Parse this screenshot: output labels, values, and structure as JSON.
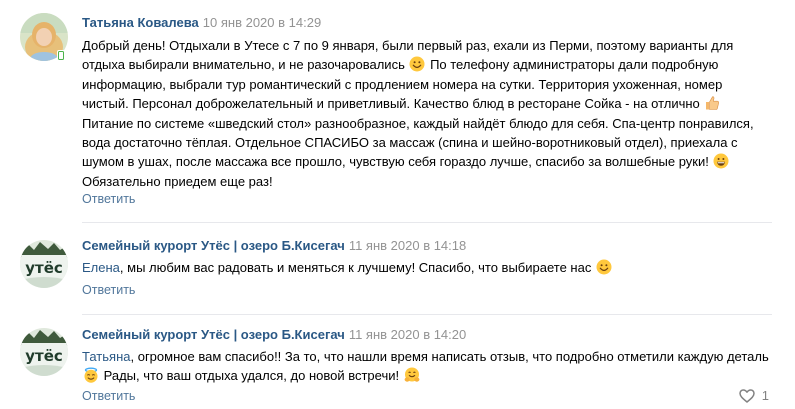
{
  "comments": [
    {
      "author": "Татьяна Ковалева",
      "date": "10 янв 2020 в 14:29",
      "text": [
        {
          "t": "Добрый день! Отдыхали в Утесе с 7 по 9 января, были первый раз, ехали из Перми, поэтому варианты для отдыха выбирали внимательно, и не разочаровались "
        },
        {
          "emoji": "smile-emoji"
        },
        {
          "t": " По телефону администраторы дали подробную информацию, выбрали тур романтический с продлением номера на сутки. Территория ухоженная, номер чистый. Персонал доброжелательный и приветливый. Качество блюд в ресторане Сойка - на отлично "
        },
        {
          "emoji": "thumbs-up-emoji"
        },
        {
          "t": " Питание по системе «шведский стол» разнообразное, каждый найдёт блюдо для себя. Спа-центр понравился, вода достаточно тёплая. Отдельное СПАСИБО за массаж (спина и шейно-воротниковый отдел), приехала с шумом в ушах, после массажа все прошло, чувствую себя гораздо лучше, спасибо за волшебные руки! "
        },
        {
          "emoji": "grin-emoji"
        },
        {
          "t": " Обязательно приедем еще раз!"
        }
      ],
      "reply_label": "Ответить"
    },
    {
      "author": "Семейный курорт Утёс | озеро Б.Кисегач",
      "date": "11 янв 2020 в 14:18",
      "text": [
        {
          "mention": "Елена"
        },
        {
          "t": ", мы любим вас радовать и меняться к лучшему! Спасибо, что выбираете нас "
        },
        {
          "emoji": "smile-emoji"
        }
      ],
      "reply_label": "Ответить"
    },
    {
      "author": "Семейный курорт Утёс | озеро Б.Кисегач",
      "date": "11 янв 2020 в 14:20",
      "text": [
        {
          "mention": "Татьяна"
        },
        {
          "t": ", огромное вам спасибо!! За то, что нашли время написать отзыв, что подробно отметили каждую деталь "
        },
        {
          "emoji": "innocent-emoji"
        },
        {
          "t": " Рады, что ваш отдыха удался, до новой встречи! "
        },
        {
          "emoji": "hug-emoji"
        }
      ],
      "reply_label": "Ответить",
      "like_count": "1"
    }
  ],
  "avatar_logo_text": "утёс",
  "colors": {
    "link": "#2a5885",
    "date": "#939393",
    "separator": "#e7e8ec",
    "online": "#4bb34b"
  }
}
